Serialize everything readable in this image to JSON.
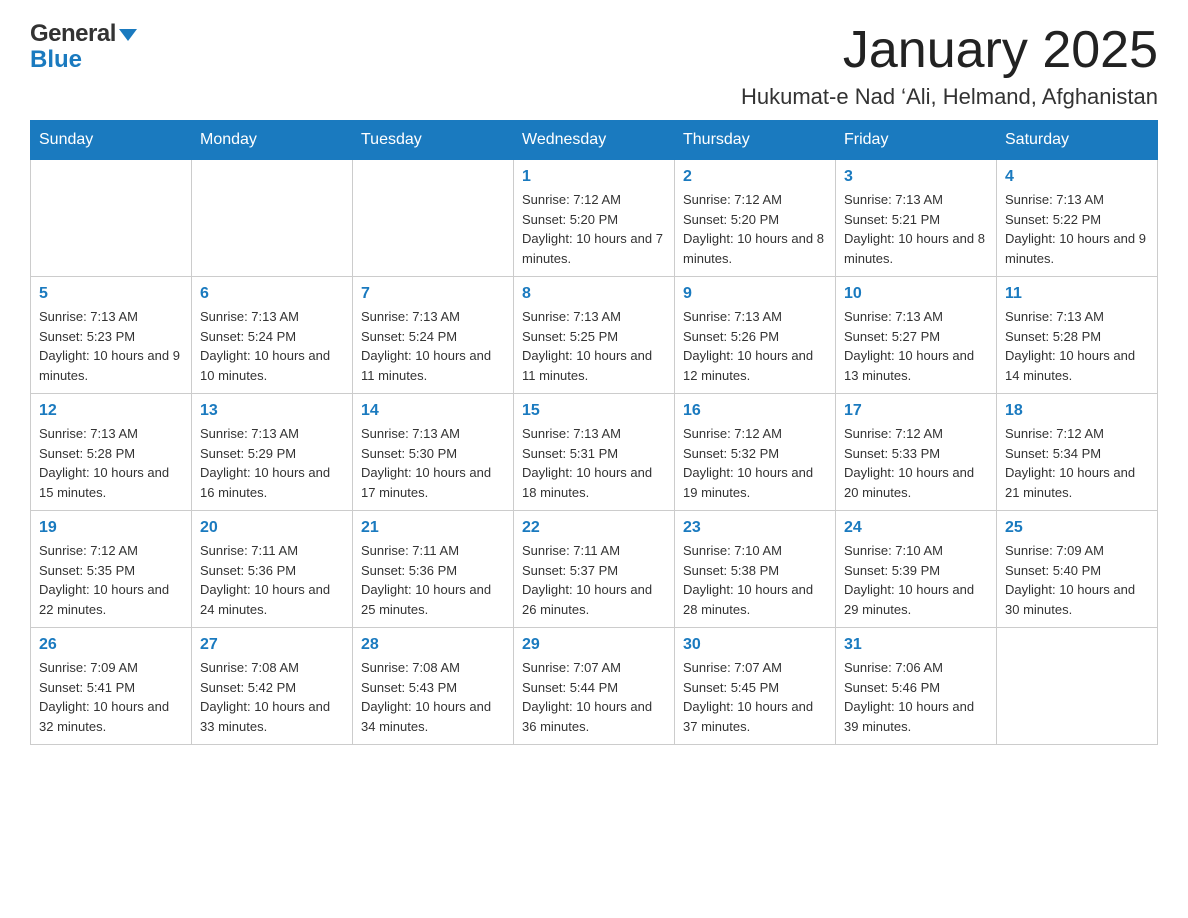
{
  "header": {
    "logo_line1": "General",
    "logo_line2": "Blue",
    "main_title": "January 2025",
    "subtitle": "Hukumat-e Nad ‘Ali, Helmand, Afghanistan"
  },
  "calendar": {
    "days_of_week": [
      "Sunday",
      "Monday",
      "Tuesday",
      "Wednesday",
      "Thursday",
      "Friday",
      "Saturday"
    ],
    "weeks": [
      [
        {
          "day": "",
          "info": ""
        },
        {
          "day": "",
          "info": ""
        },
        {
          "day": "",
          "info": ""
        },
        {
          "day": "1",
          "info": "Sunrise: 7:12 AM\nSunset: 5:20 PM\nDaylight: 10 hours and 7 minutes."
        },
        {
          "day": "2",
          "info": "Sunrise: 7:12 AM\nSunset: 5:20 PM\nDaylight: 10 hours and 8 minutes."
        },
        {
          "day": "3",
          "info": "Sunrise: 7:13 AM\nSunset: 5:21 PM\nDaylight: 10 hours and 8 minutes."
        },
        {
          "day": "4",
          "info": "Sunrise: 7:13 AM\nSunset: 5:22 PM\nDaylight: 10 hours and 9 minutes."
        }
      ],
      [
        {
          "day": "5",
          "info": "Sunrise: 7:13 AM\nSunset: 5:23 PM\nDaylight: 10 hours and 9 minutes."
        },
        {
          "day": "6",
          "info": "Sunrise: 7:13 AM\nSunset: 5:24 PM\nDaylight: 10 hours and 10 minutes."
        },
        {
          "day": "7",
          "info": "Sunrise: 7:13 AM\nSunset: 5:24 PM\nDaylight: 10 hours and 11 minutes."
        },
        {
          "day": "8",
          "info": "Sunrise: 7:13 AM\nSunset: 5:25 PM\nDaylight: 10 hours and 11 minutes."
        },
        {
          "day": "9",
          "info": "Sunrise: 7:13 AM\nSunset: 5:26 PM\nDaylight: 10 hours and 12 minutes."
        },
        {
          "day": "10",
          "info": "Sunrise: 7:13 AM\nSunset: 5:27 PM\nDaylight: 10 hours and 13 minutes."
        },
        {
          "day": "11",
          "info": "Sunrise: 7:13 AM\nSunset: 5:28 PM\nDaylight: 10 hours and 14 minutes."
        }
      ],
      [
        {
          "day": "12",
          "info": "Sunrise: 7:13 AM\nSunset: 5:28 PM\nDaylight: 10 hours and 15 minutes."
        },
        {
          "day": "13",
          "info": "Sunrise: 7:13 AM\nSunset: 5:29 PM\nDaylight: 10 hours and 16 minutes."
        },
        {
          "day": "14",
          "info": "Sunrise: 7:13 AM\nSunset: 5:30 PM\nDaylight: 10 hours and 17 minutes."
        },
        {
          "day": "15",
          "info": "Sunrise: 7:13 AM\nSunset: 5:31 PM\nDaylight: 10 hours and 18 minutes."
        },
        {
          "day": "16",
          "info": "Sunrise: 7:12 AM\nSunset: 5:32 PM\nDaylight: 10 hours and 19 minutes."
        },
        {
          "day": "17",
          "info": "Sunrise: 7:12 AM\nSunset: 5:33 PM\nDaylight: 10 hours and 20 minutes."
        },
        {
          "day": "18",
          "info": "Sunrise: 7:12 AM\nSunset: 5:34 PM\nDaylight: 10 hours and 21 minutes."
        }
      ],
      [
        {
          "day": "19",
          "info": "Sunrise: 7:12 AM\nSunset: 5:35 PM\nDaylight: 10 hours and 22 minutes."
        },
        {
          "day": "20",
          "info": "Sunrise: 7:11 AM\nSunset: 5:36 PM\nDaylight: 10 hours and 24 minutes."
        },
        {
          "day": "21",
          "info": "Sunrise: 7:11 AM\nSunset: 5:36 PM\nDaylight: 10 hours and 25 minutes."
        },
        {
          "day": "22",
          "info": "Sunrise: 7:11 AM\nSunset: 5:37 PM\nDaylight: 10 hours and 26 minutes."
        },
        {
          "day": "23",
          "info": "Sunrise: 7:10 AM\nSunset: 5:38 PM\nDaylight: 10 hours and 28 minutes."
        },
        {
          "day": "24",
          "info": "Sunrise: 7:10 AM\nSunset: 5:39 PM\nDaylight: 10 hours and 29 minutes."
        },
        {
          "day": "25",
          "info": "Sunrise: 7:09 AM\nSunset: 5:40 PM\nDaylight: 10 hours and 30 minutes."
        }
      ],
      [
        {
          "day": "26",
          "info": "Sunrise: 7:09 AM\nSunset: 5:41 PM\nDaylight: 10 hours and 32 minutes."
        },
        {
          "day": "27",
          "info": "Sunrise: 7:08 AM\nSunset: 5:42 PM\nDaylight: 10 hours and 33 minutes."
        },
        {
          "day": "28",
          "info": "Sunrise: 7:08 AM\nSunset: 5:43 PM\nDaylight: 10 hours and 34 minutes."
        },
        {
          "day": "29",
          "info": "Sunrise: 7:07 AM\nSunset: 5:44 PM\nDaylight: 10 hours and 36 minutes."
        },
        {
          "day": "30",
          "info": "Sunrise: 7:07 AM\nSunset: 5:45 PM\nDaylight: 10 hours and 37 minutes."
        },
        {
          "day": "31",
          "info": "Sunrise: 7:06 AM\nSunset: 5:46 PM\nDaylight: 10 hours and 39 minutes."
        },
        {
          "day": "",
          "info": ""
        }
      ]
    ]
  }
}
